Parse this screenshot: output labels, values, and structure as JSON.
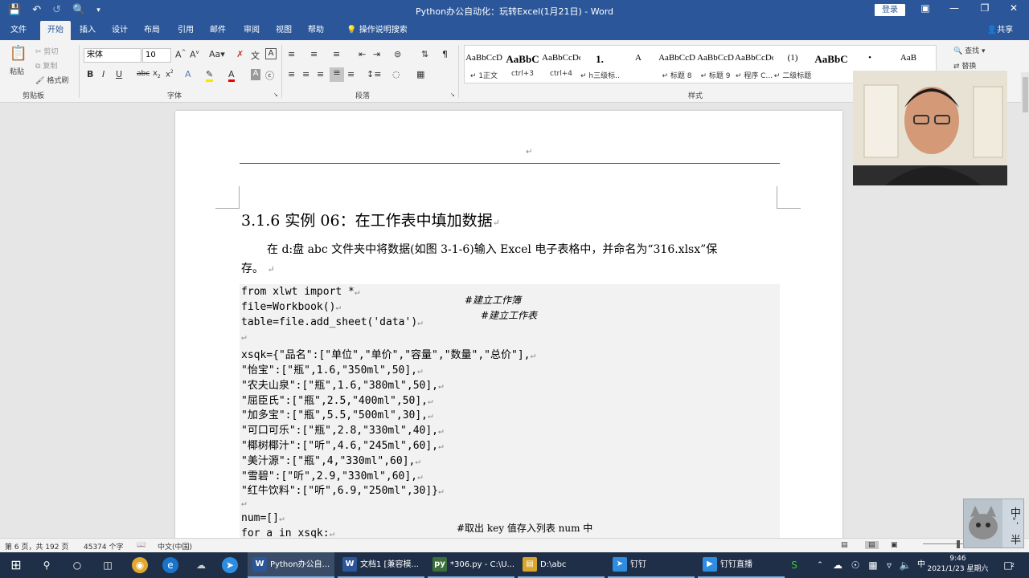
{
  "titlebar": {
    "doc_title": "Python办公自动化：玩转Excel(1月21日)  -  Word",
    "login_label": "登录",
    "icons": [
      "save-icon",
      "undo-icon",
      "redo-icon",
      "print-preview-icon"
    ]
  },
  "menubar": {
    "tabs": [
      "文件",
      "开始",
      "插入",
      "设计",
      "布局",
      "引用",
      "邮件",
      "审阅",
      "视图",
      "帮助"
    ],
    "tell_me": "操作说明搜索",
    "share": "共享"
  },
  "ribbon": {
    "clipboard": {
      "paste": "粘贴",
      "cut": "剪切",
      "copy": "复制",
      "format_painter": "格式刷",
      "group": "剪贴板"
    },
    "font": {
      "name": "宋体",
      "size": "10",
      "group": "字体"
    },
    "paragraph": {
      "group": "段落"
    },
    "styles": {
      "group": "样式",
      "items": [
        {
          "sample": "AaBbCcD",
          "label": "↵ 1正文"
        },
        {
          "sample": "AaBbC",
          "label": "ctrl+3"
        },
        {
          "sample": "AaBbCcDdl",
          "label": "ctrl+4"
        },
        {
          "sample": "1.",
          "label": "↵ h三级标..."
        },
        {
          "sample": "A",
          "label": ""
        },
        {
          "sample": "AaBbCcD",
          "label": "↵ 标题 8"
        },
        {
          "sample": "AaBbCcD",
          "label": "↵ 标题 9"
        },
        {
          "sample": "AaBbCcDdI",
          "label": "↵ 程序 C..."
        },
        {
          "sample": "(1)",
          "label": "↵ 二级标题"
        },
        {
          "sample": "AaBbC",
          "label": ""
        },
        {
          "sample": "•",
          "label": ""
        },
        {
          "sample": "AaB",
          "label": ""
        }
      ]
    },
    "editing": {
      "find": "查找",
      "replace": "替换"
    }
  },
  "document": {
    "heading": "3.1.6 实例 06：在工作表中填加数据",
    "para_line1": "在 d:盘 abc 文件夹中将数据(如图 3-1-6)输入 Excel 电子表格中，并命名为“316.xlsx”保",
    "para_line2": "存。",
    "code_lines": [
      "from xlwt import *",
      "file=Workbook()",
      "table=file.add_sheet('data')",
      "",
      "xsqk={\"品名\":[\"单位\",\"单价\",\"容量\",\"数量\",\"总价\"],",
      "\"怡宝\":[\"瓶\",1.6,\"350ml\",50],",
      "\"农夫山泉\":[\"瓶\",1.6,\"380ml\",50],",
      "\"屈臣氏\":[\"瓶\",2.5,\"400ml\",50],",
      "\"加多宝\":[\"瓶\",5.5,\"500ml\",30],",
      "\"可口可乐\":[\"瓶\",2.8,\"330ml\",40],",
      "\"椰树椰汁\":[\"听\",4.6,\"245ml\",60],",
      "\"美汁源\":[\"瓶\",4,\"330ml\",60],",
      "\"雪碧\":[\"听\",2.9,\"330ml\",60],",
      "\"红牛饮料\":[\"听\",6.9,\"250ml\",30]}",
      "",
      "num=[]",
      "for a in xsqk:"
    ],
    "comments": {
      "workbook": "#建立工作簿",
      "sheet": "#建立工作表",
      "keys": "#取出 key 值存入列表 num 中"
    }
  },
  "statusbar": {
    "page": "第 6 页，共 192 页",
    "words": "45374 个字",
    "language": "中文(中国)"
  },
  "taskbar": {
    "apps": [
      {
        "label": "Python办公自...",
        "icon": "W"
      },
      {
        "label": "文档1 [兼容模...",
        "icon": "W"
      },
      {
        "label": "*306.py - C:\\U...",
        "icon": "py"
      },
      {
        "label": "D:\\abc",
        "icon": "folder"
      },
      {
        "label": "钉钉",
        "icon": "dingtalk"
      },
      {
        "label": "钉钉直播",
        "icon": "live"
      }
    ],
    "time": "9:46",
    "date": "2021/1/23 星期六",
    "ime": "中",
    "notification_count": "2"
  },
  "ime_box": {
    "line1": "中",
    "line2": "°,",
    "line3": "半"
  }
}
